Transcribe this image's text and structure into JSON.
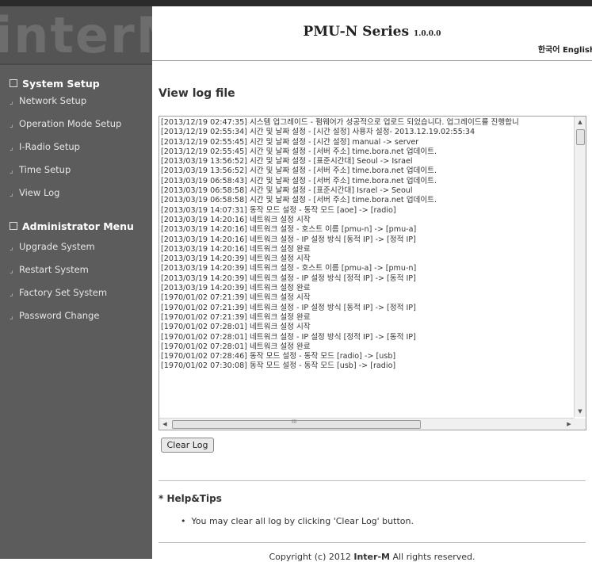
{
  "logo": {
    "text": "interM"
  },
  "header": {
    "title": "PMU-N Series",
    "version": "1.0.0.0",
    "lang_korean": "한국어",
    "lang_english": "English"
  },
  "sidebar": {
    "system_setup": {
      "title": "System Setup",
      "items": [
        "Network Setup",
        "Operation Mode Setup",
        "I-Radio Setup",
        "Time Setup",
        "View Log"
      ]
    },
    "admin_menu": {
      "title": "Administrator Menu",
      "items": [
        "Upgrade System",
        "Restart System",
        "Factory Set System",
        "Password Change"
      ]
    }
  },
  "main": {
    "page_title": "View log file",
    "log_lines": [
      "[2013/12/19 02:47:35] 시스템 업그레이드 - 펌웨어가 성공적으로 업로드 되었습니다. 업그레이드를 진행합니",
      "[2013/12/19 02:55:34] 시간 및 날짜 설정 - [시간 설정] 사용자 설정- 2013.12.19.02:55:34",
      "[2013/12/19 02:55:45] 시간 및 날짜 설정 - [시간 설정] manual -> server",
      "[2013/12/19 02:55:45] 시간 및 날짜 설정 - [서버 주소] time.bora.net 업데이트.",
      "[2013/03/19 13:56:52] 시간 및 날짜 설정 - [표준시간대] Seoul -> Israel",
      "[2013/03/19 13:56:52] 시간 및 날짜 설정 - [서버 주소] time.bora.net 업데이트.",
      "[2013/03/19 06:58:43] 시간 및 날짜 설정 - [서버 주소] time.bora.net 업데이트.",
      "[2013/03/19 06:58:58] 시간 및 날짜 설정 - [표준시간대] Israel -> Seoul",
      "[2013/03/19 06:58:58] 시간 및 날짜 설정 - [서버 주소] time.bora.net 업데이트.",
      "[2013/03/19 14:07:31] 동작 모드 설정 - 동작 모드 [aoe] -> [radio]",
      "[2013/03/19 14:20:16] 네트워크 설정 시작",
      "[2013/03/19 14:20:16] 네트워크 설정 - 호스트 이름 [pmu-n] -> [pmu-a]",
      "[2013/03/19 14:20:16] 네트워크 설정 - IP 설정 방식 [동적 IP] -> [정적 IP]",
      "[2013/03/19 14:20:16] 네트워크 설정 완료",
      "[2013/03/19 14:20:39] 네트워크 설정 시작",
      "[2013/03/19 14:20:39] 네트워크 설정 - 호스트 이름 [pmu-a] -> [pmu-n]",
      "[2013/03/19 14:20:39] 네트워크 설정 - IP 설정 방식 [정적 IP] -> [동적 IP]",
      "[2013/03/19 14:20:39] 네트워크 설정 완료",
      "[1970/01/02 07:21:39] 네트워크 설정 시작",
      "[1970/01/02 07:21:39] 네트워크 설정 - IP 설정 방식 [동적 IP] -> [정적 IP]",
      "[1970/01/02 07:21:39] 네트워크 설정 완료",
      "[1970/01/02 07:28:01] 네트워크 설정 시작",
      "[1970/01/02 07:28:01] 네트워크 설정 - IP 설정 방식 [정적 IP] -> [동적 IP]",
      "[1970/01/02 07:28:01] 네트워크 설정 완료",
      "[1970/01/02 07:28:46] 동작 모드 설정 - 동작 모드 [radio] -> [usb]",
      "[1970/01/02 07:30:08] 동작 모드 설정 - 동작 모드 [usb] -> [radio]"
    ],
    "clear_button": "Clear Log",
    "help_title": "* Help&Tips",
    "help_items": [
      "You may clear all log by clicking 'Clear Log' button."
    ],
    "copyright_prefix": "Copyright (c) 2012 ",
    "copyright_brand": "Inter-M",
    "copyright_suffix": " All rights reserved."
  },
  "icons": {
    "scroll_up": "▲",
    "scroll_down": "▼",
    "scroll_left": "◀",
    "scroll_right": "▶",
    "thumb_grip": "III"
  },
  "colors": {
    "sidebar_bg": "#5c5c5c",
    "topbar": "#2b2b2b"
  }
}
